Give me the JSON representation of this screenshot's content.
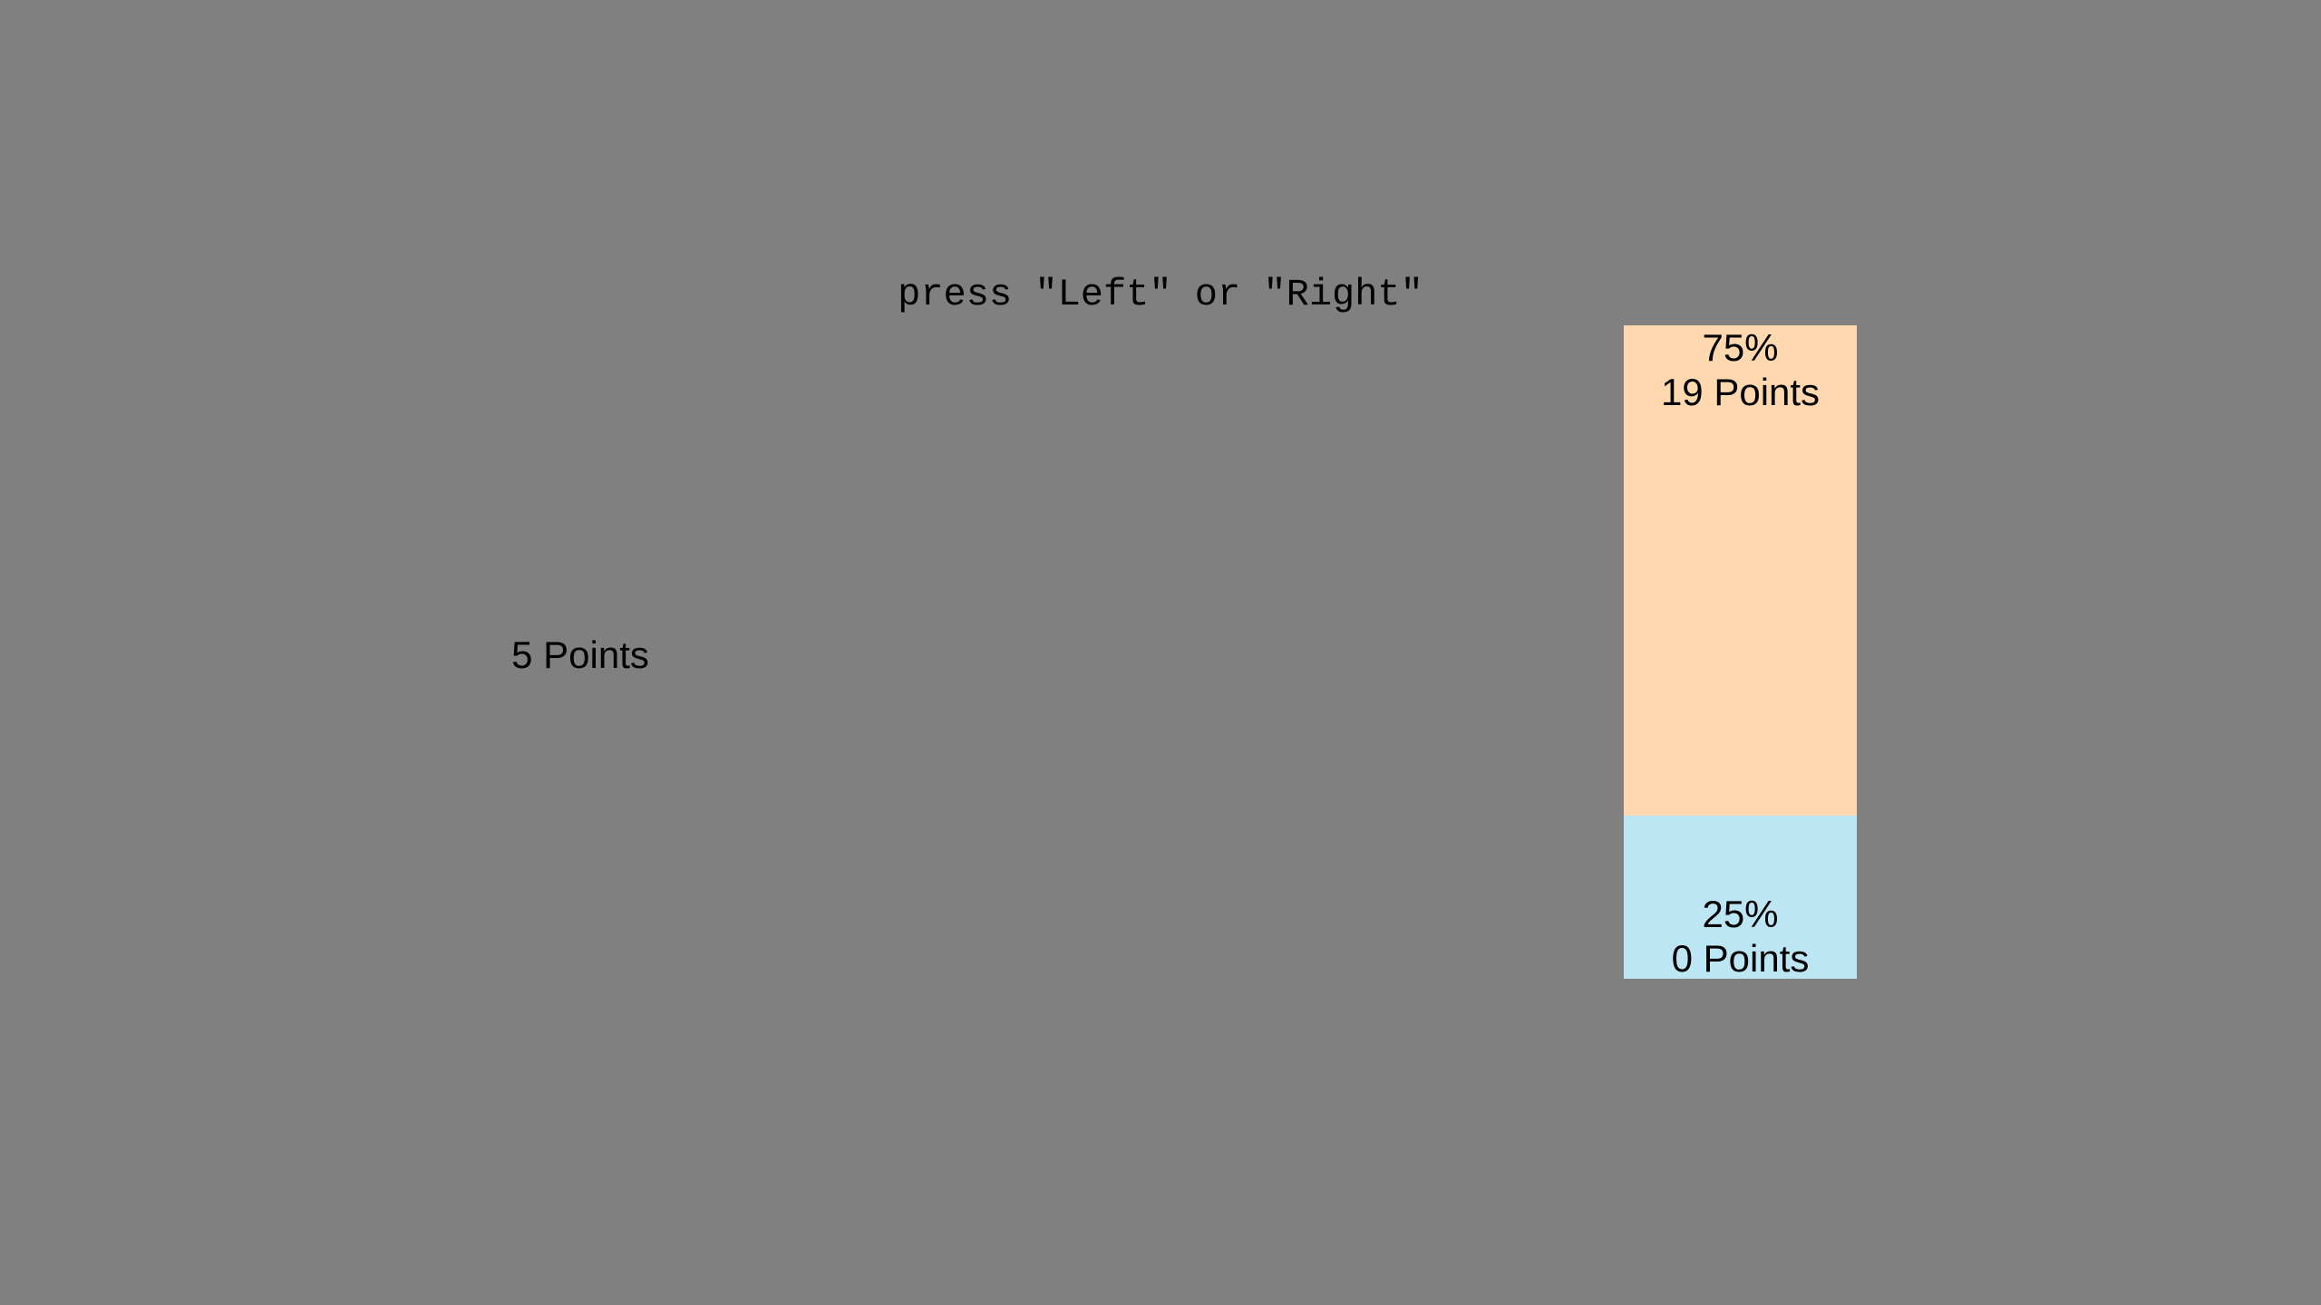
{
  "instruction": "press \"Left\" or \"Right\"",
  "sure_option": {
    "label": "5 Points"
  },
  "gamble_option": {
    "segments": [
      {
        "probability_label": "75%",
        "points_label": "19 Points",
        "probability": 0.75,
        "color": "#FFD8B0"
      },
      {
        "probability_label": "25%",
        "points_label": "0 Points",
        "probability": 0.25,
        "color": "#BDE6F5"
      }
    ]
  },
  "colors": {
    "background": "#808080",
    "text": "#000000"
  }
}
